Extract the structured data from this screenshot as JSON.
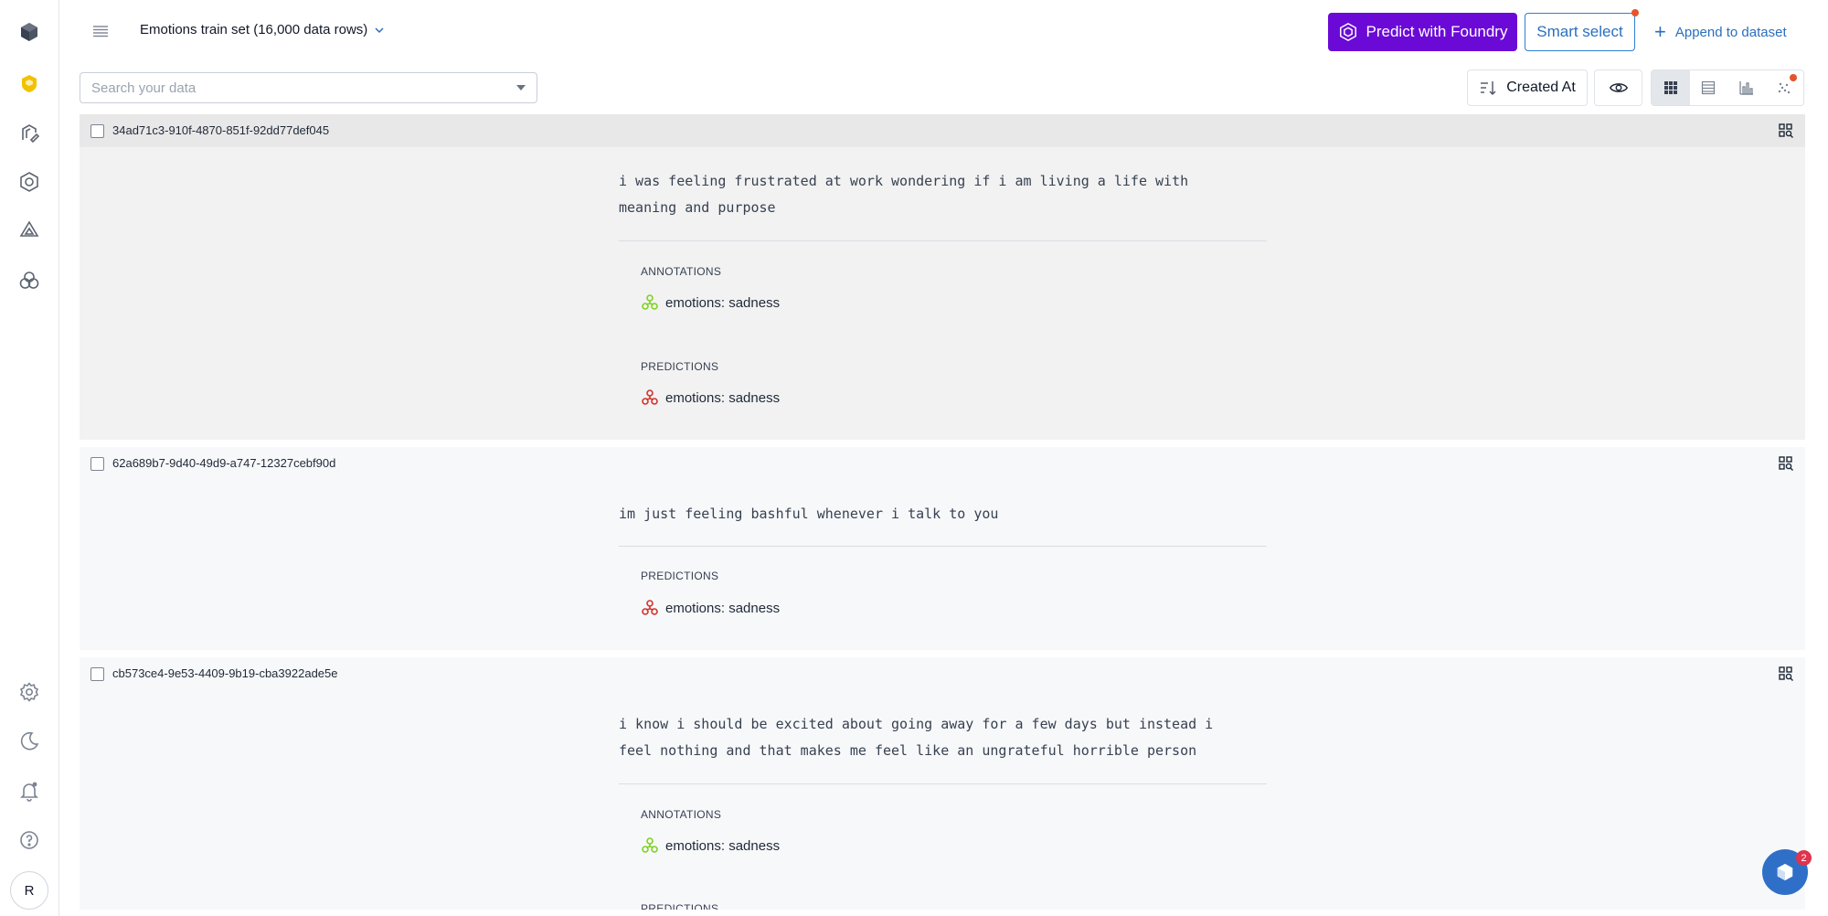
{
  "header": {
    "dataset_title": "Emotions train set (16,000 data rows)",
    "predict_label": "Predict with Foundry",
    "smart_select_label": "Smart select",
    "append_label": "Append to dataset"
  },
  "toolbar": {
    "search_placeholder": "Search your data",
    "sort_label": "Created At"
  },
  "sidebar": {
    "avatar_initial": "R",
    "icons": [
      "logo-icon",
      "catalog-icon",
      "annotate-icon",
      "model-icon",
      "ontology-icon",
      "workflow-icon",
      "settings-icon",
      "dark-mode-icon",
      "notifications-icon",
      "help-icon"
    ]
  },
  "rows": [
    {
      "id": "34ad71c3-910f-4870-851f-92dd77def045",
      "text": "i was feeling frustrated at work wondering if i am living a life with meaning and purpose",
      "annotations_label": "ANNOTATIONS",
      "annotation": "emotions: sadness",
      "predictions_label": "PREDICTIONS",
      "prediction": "emotions: sadness"
    },
    {
      "id": "62a689b7-9d40-49d9-a747-12327cebf90d",
      "text": "im just feeling bashful whenever i talk to you",
      "predictions_label": "PREDICTIONS",
      "prediction": "emotions: sadness"
    },
    {
      "id": "cb573ce4-9e53-4409-9b19-cba3922ade5e",
      "text": "i know i should be excited about going away for a few days but instead i feel nothing and that makes me feel like an ungrateful horrible person",
      "annotations_label": "ANNOTATIONS",
      "annotation": "emotions: sadness",
      "predictions_label": "PREDICTIONS"
    }
  ],
  "chat": {
    "badge_count": "2"
  },
  "colors": {
    "accent_purple": "#6b0ad6",
    "link_blue": "#2a6fbf",
    "annotation_green": "#7ed321",
    "prediction_red": "#d0342c",
    "notification_orange": "#e5532b"
  }
}
